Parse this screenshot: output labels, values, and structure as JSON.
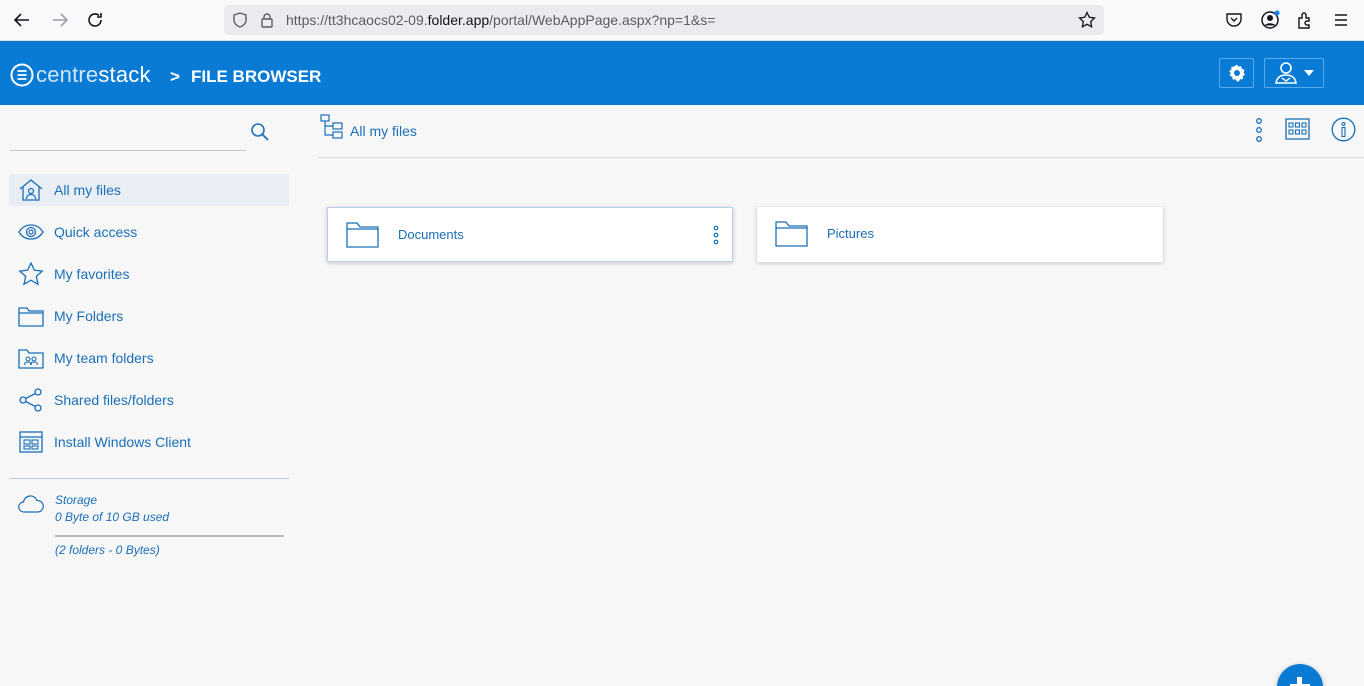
{
  "browser": {
    "url_prefix": "https://tt3hcaocs02-09.",
    "url_domain": "folder.app",
    "url_path": "/portal/WebAppPage.aspx?np=1&s="
  },
  "header": {
    "logo_text_light": "centre",
    "logo_text_bold": "stack",
    "separator": ">",
    "title": "FILE BROWSER"
  },
  "sidebar": {
    "search_value": "",
    "items": [
      {
        "label": "All my files",
        "icon": "home-icon",
        "active": true
      },
      {
        "label": "Quick access",
        "icon": "eye-icon"
      },
      {
        "label": "My favorites",
        "icon": "star-icon"
      },
      {
        "label": "My Folders",
        "icon": "folder-icon"
      },
      {
        "label": "My team folders",
        "icon": "team-folder-icon"
      },
      {
        "label": "Shared files/folders",
        "icon": "share-icon"
      },
      {
        "label": "Install Windows Client",
        "icon": "windows-client-icon"
      }
    ],
    "storage": {
      "title": "Storage",
      "used": "0 Byte of 10 GB used",
      "usage_fraction": 0,
      "summary": "(2 folders - 0 Bytes)"
    }
  },
  "main": {
    "path_label": "All my files",
    "folders": [
      {
        "name": "Documents",
        "selected": true
      },
      {
        "name": "Pictures",
        "selected": false
      }
    ]
  },
  "colors": {
    "brand": "#0a7bd5",
    "link": "#1a6fb8"
  }
}
